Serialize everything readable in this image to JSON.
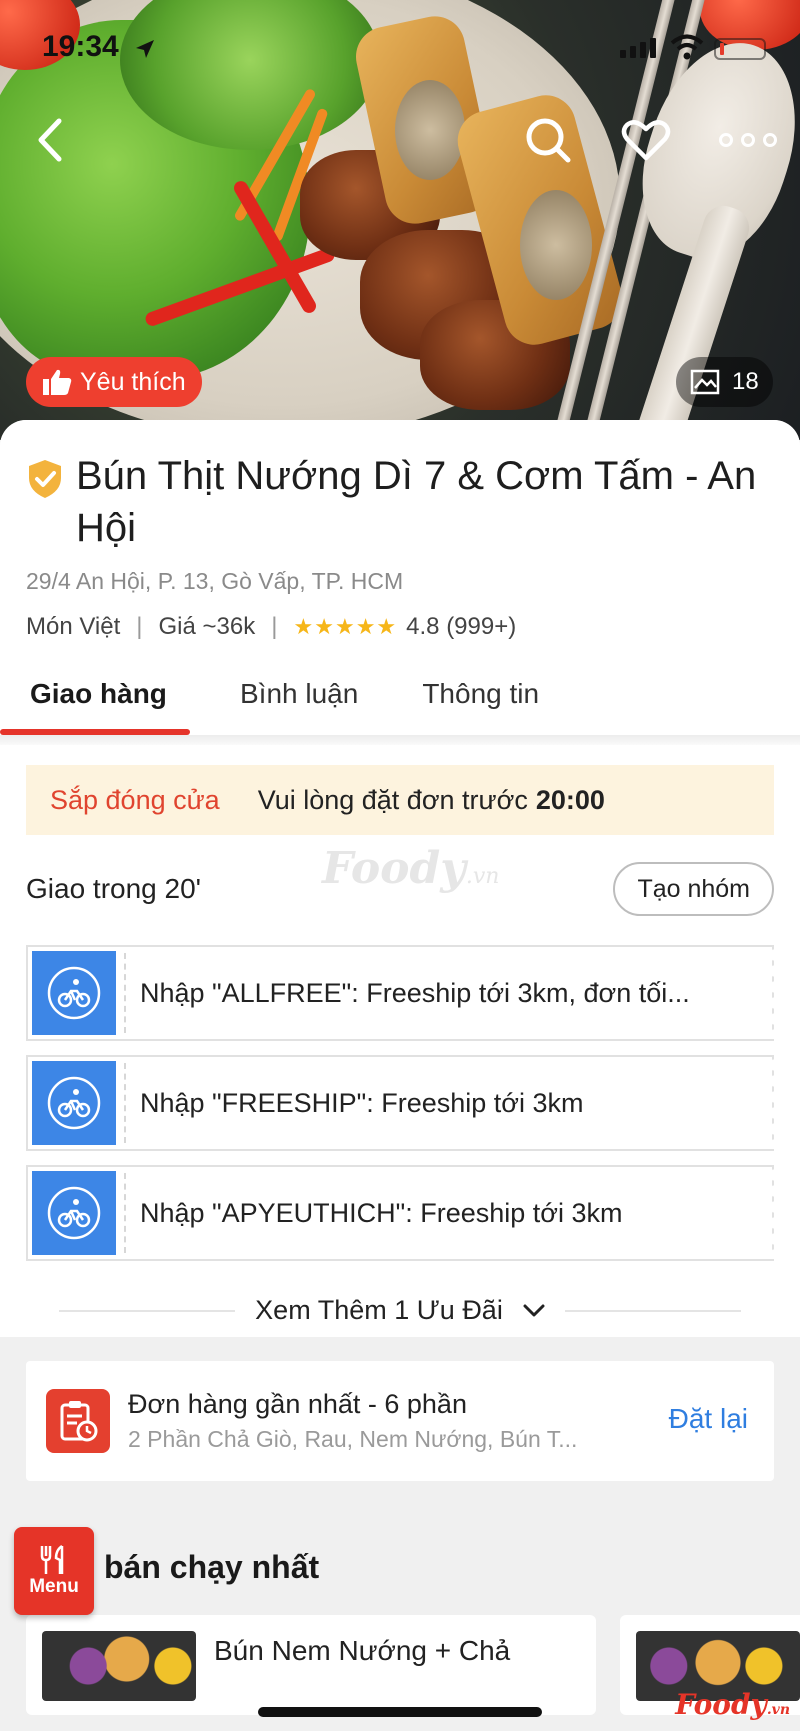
{
  "status_bar": {
    "time": "19:34"
  },
  "hero": {
    "favorite_badge": "Yêu thích",
    "photo_count": "18",
    "icons": [
      "back-icon",
      "search-icon",
      "heart-icon",
      "more-icon"
    ]
  },
  "restaurant": {
    "name": "Bún Thịt Nướng Dì 7 & Cơm Tấm - An Hội",
    "address": "29/4 An Hội, P. 13, Gò Vấp, TP. HCM",
    "cuisine": "Món Việt",
    "price": "Giá ~36k",
    "rating_stars": 5,
    "rating": "4.8 (999+)"
  },
  "tabs": [
    {
      "label": "Giao hàng",
      "active": true
    },
    {
      "label": "Bình luận",
      "active": false
    },
    {
      "label": "Thông tin",
      "active": false
    }
  ],
  "closing_notice": {
    "status": "Sắp đóng cửa",
    "message": "Vui lòng đặt đơn trước",
    "time": "20:00"
  },
  "delivery": {
    "eta": "Giao trong 20'",
    "group_button": "Tạo nhóm",
    "watermark": "Foody",
    "watermark_suffix": ".vn"
  },
  "promos": [
    {
      "text": "Nhập \"ALLFREE\": Freeship tới 3km, đơn tối..."
    },
    {
      "text": "Nhập \"FREESHIP\": Freeship tới 3km"
    },
    {
      "text": "Nhập \"APYEUTHICH\": Freeship tới 3km"
    }
  ],
  "see_more": "Xem Thêm 1 Ưu Đãi",
  "recent_order": {
    "title": "Đơn hàng gần nhất - 6 phần",
    "items": "2 Phần Chả Giò, Rau, Nem Nướng, Bún T...",
    "reorder": "Đặt lại"
  },
  "bestseller": {
    "menu_label": "Menu",
    "title": "bán chạy nhất",
    "dish_name": "Bún Nem Nướng + Chả"
  },
  "brand": {
    "name": "Foody",
    "suffix": ".vn"
  },
  "colors": {
    "accent": "#e53428",
    "promo_blue": "#3d86e6",
    "link_blue": "#2f7ee0",
    "closing_bg": "#fdf3de"
  }
}
